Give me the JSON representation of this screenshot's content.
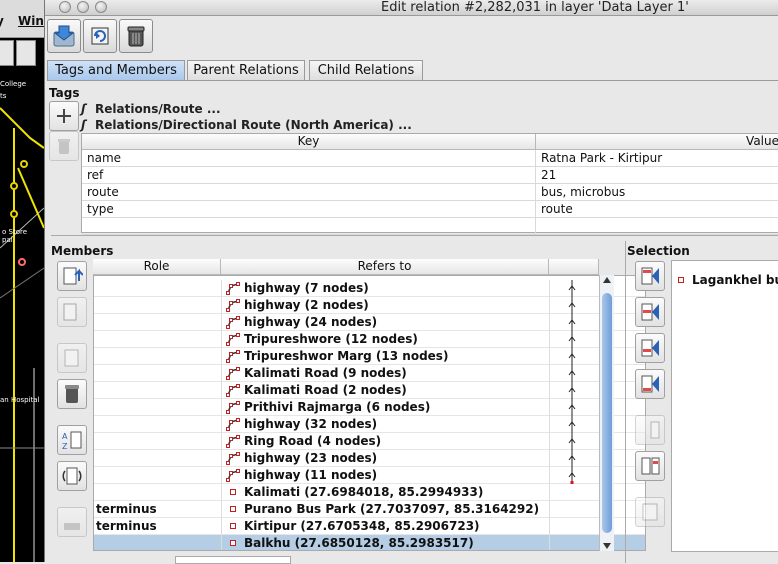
{
  "background_app": {
    "menu": [
      "y",
      "Win"
    ],
    "map_labels": [
      "College",
      "ts",
      "o Store",
      "pal",
      "an Hospital"
    ]
  },
  "window": {
    "title": "Edit relation #2,282,031 in layer 'Data Layer 1'"
  },
  "toolbar": {
    "apply_icon": "apply-changes-icon",
    "refresh_icon": "refresh-relation-icon",
    "delete_icon": "delete-relation-icon"
  },
  "tabs": [
    {
      "label": "Tags and Members",
      "active": true
    },
    {
      "label": "Parent Relations",
      "active": false
    },
    {
      "label": "Child Relations",
      "active": false
    }
  ],
  "tags": {
    "section_label": "Tags",
    "presets": [
      "Relations/Route ...",
      "Relations/Directional Route (North America) ..."
    ],
    "columns": [
      "Key",
      "Value"
    ],
    "rows": [
      {
        "key": "name",
        "value": "Ratna Park - Kirtipur"
      },
      {
        "key": "ref",
        "value": "21"
      },
      {
        "key": "route",
        "value": "bus, microbus"
      },
      {
        "key": "type",
        "value": "route"
      }
    ]
  },
  "members": {
    "section_label": "Members",
    "columns": [
      "Role",
      "Refers to"
    ],
    "rows": [
      {
        "role": "",
        "ref": "highway (7 nodes)",
        "kind": "way"
      },
      {
        "role": "",
        "ref": "highway (2 nodes)",
        "kind": "way"
      },
      {
        "role": "",
        "ref": "highway (24 nodes)",
        "kind": "way"
      },
      {
        "role": "",
        "ref": "Tripureshwore (12 nodes)",
        "kind": "way"
      },
      {
        "role": "",
        "ref": "Tripureshwor Marg (13 nodes)",
        "kind": "way"
      },
      {
        "role": "",
        "ref": "Kalimati Road (9 nodes)",
        "kind": "way"
      },
      {
        "role": "",
        "ref": "Kalimati Road (2 nodes)",
        "kind": "way"
      },
      {
        "role": "",
        "ref": "Prithivi Rajmarga (6 nodes)",
        "kind": "way"
      },
      {
        "role": "",
        "ref": "highway (32 nodes)",
        "kind": "way"
      },
      {
        "role": "",
        "ref": "Ring Road (4 nodes)",
        "kind": "way"
      },
      {
        "role": "",
        "ref": "highway (23 nodes)",
        "kind": "way"
      },
      {
        "role": "",
        "ref": "highway (11 nodes)",
        "kind": "way"
      },
      {
        "role": "",
        "ref": "Kalimati (27.6984018, 85.2994933)",
        "kind": "node"
      },
      {
        "role": "terminus",
        "ref": "Purano Bus Park (27.7037097, 85.3164292)",
        "kind": "node"
      },
      {
        "role": "terminus",
        "ref": "Kirtipur (27.6705348, 85.2906723)",
        "kind": "node"
      },
      {
        "role": "",
        "ref": "Balkhu (27.6850128, 85.2983517)",
        "kind": "node",
        "selected": true
      }
    ]
  },
  "selection": {
    "section_label": "Selection",
    "items": [
      "Lagankhel bus"
    ]
  }
}
